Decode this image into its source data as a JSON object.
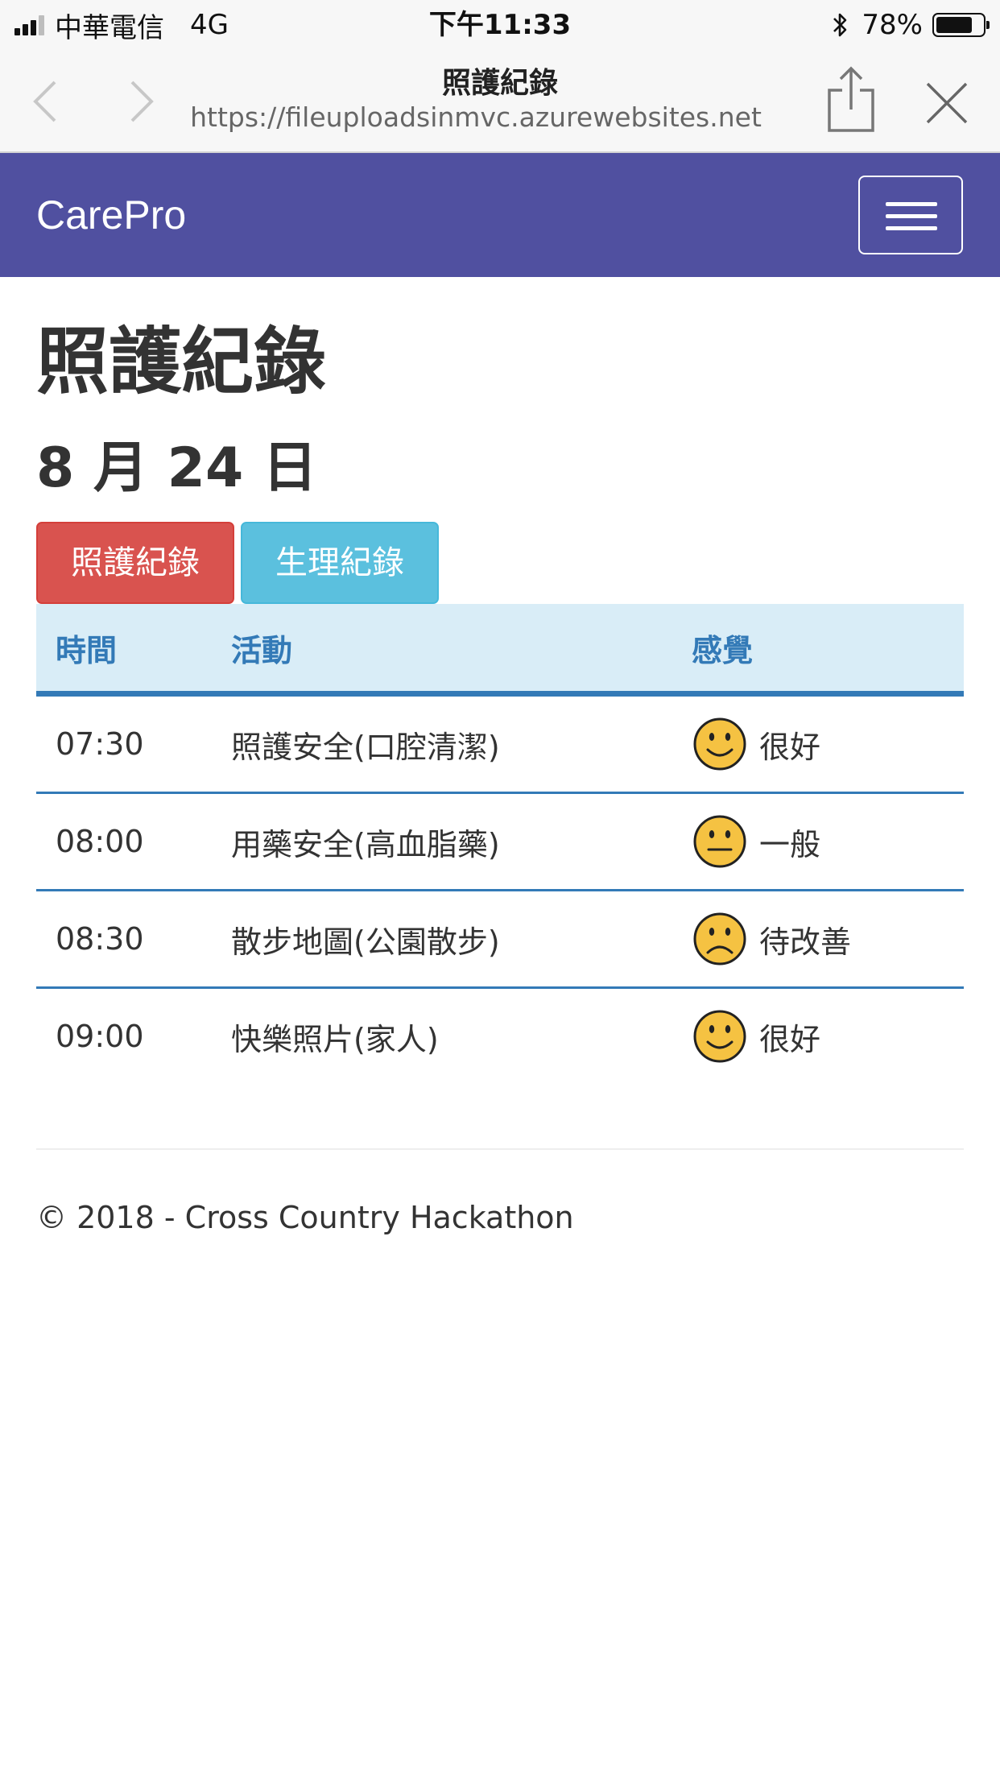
{
  "status_bar": {
    "carrier": "中華電信",
    "network": "4G",
    "time": "下午11:33",
    "battery_percent_label": "78%",
    "battery_level": 0.78
  },
  "browser": {
    "page_title": "照護紀錄",
    "url": "https://fileuploadsinmvc.azurewebsites.net"
  },
  "navbar": {
    "brand": "CarePro",
    "color": "#5050a0"
  },
  "page": {
    "heading": "照護紀錄",
    "date": "8 月 24 日"
  },
  "tabs": [
    {
      "label": "照護紀錄",
      "color": "#d9534f"
    },
    {
      "label": "生理紀錄",
      "color": "#5bc0de"
    }
  ],
  "table": {
    "headers": [
      "時間",
      "活動",
      "感覺"
    ],
    "rows": [
      {
        "time": "07:30",
        "activity": "照護安全(口腔清潔)",
        "feeling": "很好",
        "icon": "smile-face-icon"
      },
      {
        "time": "08:00",
        "activity": "用藥安全(高血脂藥)",
        "feeling": "一般",
        "icon": "neutral-face-icon"
      },
      {
        "time": "08:30",
        "activity": "散步地圖(公園散步)",
        "feeling": "待改善",
        "icon": "sad-face-icon"
      },
      {
        "time": "09:00",
        "activity": "快樂照片(家人)",
        "feeling": "很好",
        "icon": "smile-face-icon"
      }
    ]
  },
  "footer": {
    "text": "© 2018 - Cross Country Hackathon"
  }
}
